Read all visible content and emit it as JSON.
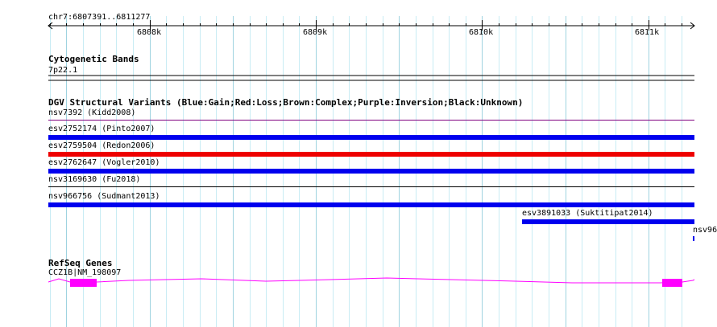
{
  "position": {
    "label": "chr7:6807391..6811277",
    "start": 6807391,
    "end": 6811277
  },
  "ruler": {
    "ticks": [
      {
        "pos": 6808000,
        "label": "6808k"
      },
      {
        "pos": 6809000,
        "label": "6809k"
      },
      {
        "pos": 6810000,
        "label": "6810k"
      },
      {
        "pos": 6811000,
        "label": "6811k"
      }
    ]
  },
  "tracks": {
    "cytoband": {
      "title": "Cytogenetic Bands",
      "band": "7p22.1"
    },
    "dgv": {
      "title": "DGV Structural Variants (Blue:Gain;Red:Loss;Brown:Complex;Purple:Inversion;Black:Unknown)",
      "features": [
        {
          "label": "nsv7392 (Kidd2008)",
          "type": "Inversion",
          "color": "#800080",
          "thin": true
        },
        {
          "label": "esv2752174 (Pinto2007)",
          "type": "Gain",
          "color": "#0000ee"
        },
        {
          "label": "esv2759504 (Redon2006)",
          "type": "Loss",
          "color": "#ee0000"
        },
        {
          "label": "esv2762647 (Vogler2010)",
          "type": "Gain",
          "color": "#0000ee"
        },
        {
          "label": "nsv3169630 (Fu2018)",
          "type": "Unknown",
          "color": "#000000",
          "thin": true
        },
        {
          "label": "nsv966756 (Sudmant2013)",
          "type": "Gain",
          "color": "#0000ee"
        },
        {
          "label": "esv3891033 (Suktitipat2014)",
          "type": "Gain",
          "color": "#0000ee"
        },
        {
          "label": "nsv96",
          "type": "Gain",
          "color": "#0000ee"
        }
      ]
    },
    "refseq": {
      "title": "RefSeq Genes",
      "gene_label": "CCZ1B|NM_198097",
      "color": "#ff00ff"
    }
  }
}
